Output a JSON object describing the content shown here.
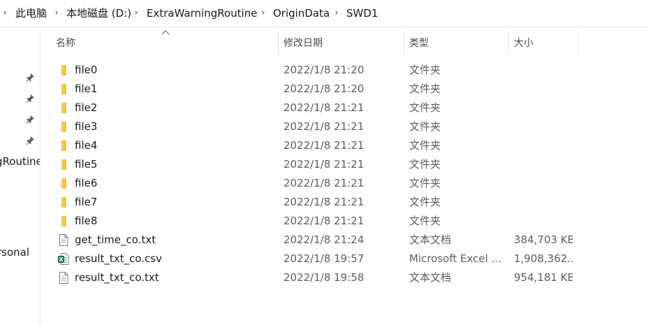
{
  "breadcrumb": {
    "items": [
      "此电脑",
      "本地磁盘 (D:)",
      "ExtraWarningRoutine",
      "OriginData",
      "SWD1"
    ]
  },
  "nav": {
    "labels": [
      "gRoutine",
      "rsonal"
    ]
  },
  "columns": {
    "name": "名称",
    "date": "修改日期",
    "type": "类型",
    "size": "大小"
  },
  "files": [
    {
      "name": "file0",
      "date": "2022/1/8 21:20",
      "type": "文件夹",
      "size": "",
      "icon": "folder-icon"
    },
    {
      "name": "file1",
      "date": "2022/1/8 21:20",
      "type": "文件夹",
      "size": "",
      "icon": "folder-icon"
    },
    {
      "name": "file2",
      "date": "2022/1/8 21:21",
      "type": "文件夹",
      "size": "",
      "icon": "folder-icon"
    },
    {
      "name": "file3",
      "date": "2022/1/8 21:21",
      "type": "文件夹",
      "size": "",
      "icon": "folder-icon"
    },
    {
      "name": "file4",
      "date": "2022/1/8 21:21",
      "type": "文件夹",
      "size": "",
      "icon": "folder-icon"
    },
    {
      "name": "file5",
      "date": "2022/1/8 21:21",
      "type": "文件夹",
      "size": "",
      "icon": "folder-icon"
    },
    {
      "name": "file6",
      "date": "2022/1/8 21:21",
      "type": "文件夹",
      "size": "",
      "icon": "folder-icon"
    },
    {
      "name": "file7",
      "date": "2022/1/8 21:21",
      "type": "文件夹",
      "size": "",
      "icon": "folder-icon"
    },
    {
      "name": "file8",
      "date": "2022/1/8 21:21",
      "type": "文件夹",
      "size": "",
      "icon": "folder-icon"
    },
    {
      "name": "get_time_co.txt",
      "date": "2022/1/8 21:24",
      "type": "文本文档",
      "size": "384,703 KB",
      "icon": "text-file-icon"
    },
    {
      "name": "result_txt_co.csv",
      "date": "2022/1/8 19:57",
      "type": "Microsoft Excel ...",
      "size": "1,908,362...",
      "icon": "excel-file-icon"
    },
    {
      "name": "result_txt_co.txt",
      "date": "2022/1/8 19:58",
      "type": "文本文档",
      "size": "954,181 KB",
      "icon": "text-file-icon"
    }
  ],
  "colors": {
    "folder": "#f7c948",
    "excel": "#1d7044"
  }
}
